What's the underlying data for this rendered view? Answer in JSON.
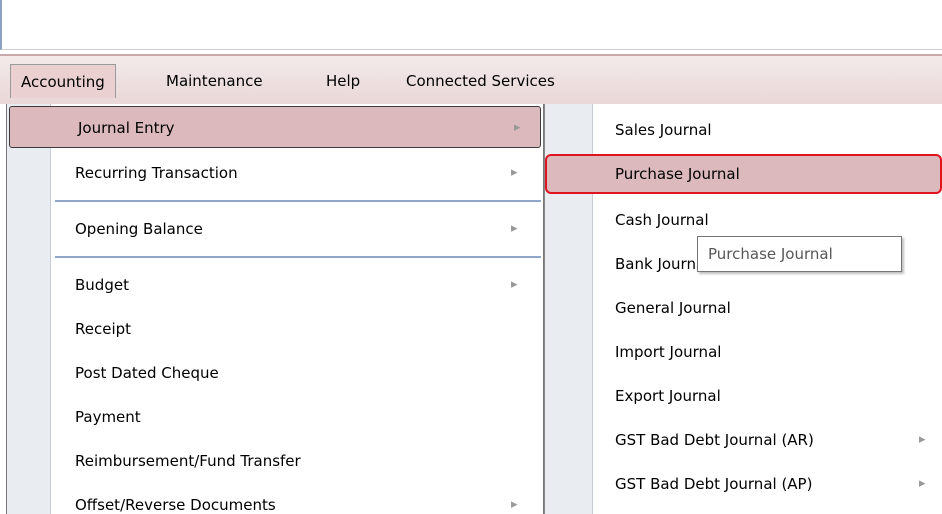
{
  "menubar": {
    "items": [
      {
        "label": "Accounting"
      },
      {
        "label": "Maintenance"
      },
      {
        "label": "Help"
      },
      {
        "label": "Connected Services"
      }
    ]
  },
  "accounting_menu": {
    "items": [
      {
        "label": "Journal Entry",
        "has_submenu": true,
        "highlighted": true
      },
      {
        "label": "Recurring Transaction",
        "has_submenu": true
      },
      {
        "label": "Opening Balance",
        "has_submenu": true
      },
      {
        "label": "Budget",
        "has_submenu": true
      },
      {
        "label": "Receipt"
      },
      {
        "label": "Post Dated Cheque"
      },
      {
        "label": "Payment"
      },
      {
        "label": "Reimbursement/Fund Transfer"
      },
      {
        "label": "Offset/Reverse Documents",
        "has_submenu": true
      }
    ]
  },
  "journal_submenu": {
    "items": [
      {
        "label": "Sales Journal"
      },
      {
        "label": "Purchase Journal",
        "highlighted": true
      },
      {
        "label": "Cash Journal"
      },
      {
        "label": "Bank Journal"
      },
      {
        "label": "General Journal"
      },
      {
        "label": "Import Journal"
      },
      {
        "label": "Export Journal"
      },
      {
        "label": "GST Bad Debt Journal (AR)",
        "has_submenu": true
      },
      {
        "label": "GST Bad Debt Journal (AP)",
        "has_submenu": true
      }
    ]
  },
  "tooltip": {
    "text": "Purchase Journal"
  },
  "icons": {
    "submenu_arrow": "chevron-right-icon"
  },
  "colors": {
    "highlight_bg": "#dcb9bc",
    "focus_outline": "#e0141e",
    "gutter": "#e9edf2",
    "separator": "#90a6c8"
  }
}
